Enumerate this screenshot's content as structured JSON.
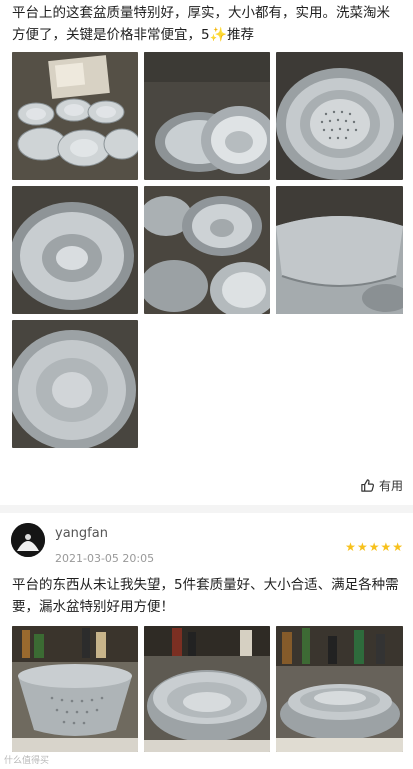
{
  "review1": {
    "text_part1": "平台上的这套盆质量特别好，厚实，大小都有，实用。洗菜淘米方便了，关键是价格非常便宜，5",
    "star_icon": "star-icon",
    "text_part2": "推荐",
    "photos": [
      {
        "label": "盆组合与包装"
      },
      {
        "label": "叠放的盆"
      },
      {
        "label": "漏水盆"
      },
      {
        "label": "大号盆"
      },
      {
        "label": "多个盆"
      },
      {
        "label": "盆侧面"
      },
      {
        "label": "盆底"
      }
    ]
  },
  "helpful": {
    "icon": "thumbs-up-icon",
    "label": "有用"
  },
  "review2": {
    "username": "yangfan",
    "date": "2021-03-05 20:05",
    "rating": 5,
    "stars": [
      "★",
      "★",
      "★",
      "★",
      "★"
    ],
    "text": "平台的东西从未让我失望，5件套质量好、大小合适、满足各种需要，漏水盆特别好用方便！",
    "photos": [
      {
        "label": "漏水盆"
      },
      {
        "label": "叠放的盆"
      },
      {
        "label": "套盆"
      }
    ]
  },
  "watermark": "什么值得买"
}
